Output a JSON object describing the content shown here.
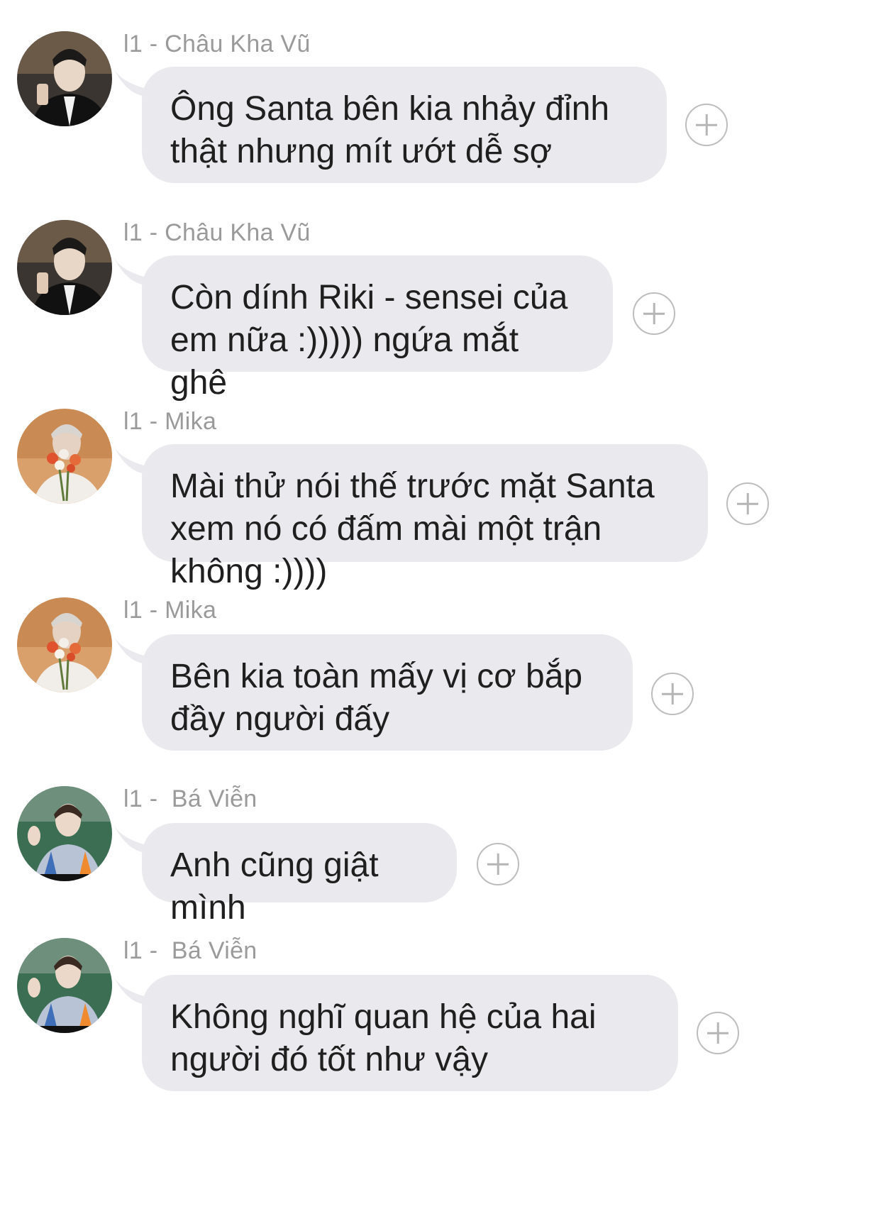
{
  "messages": [
    {
      "sender": "l1 - Châu Kha Vũ",
      "avatar": "avatar-chau-kha-vu",
      "text": "Ông Santa bên kia nhảy đỉnh thật nhưng mít ướt dễ sợ"
    },
    {
      "sender": "l1 - Châu Kha Vũ",
      "avatar": "avatar-chau-kha-vu",
      "text": "Còn dính Riki - sensei của em nữa :))))) ngứa mắt ghê"
    },
    {
      "sender": "l1 - Mika",
      "avatar": "avatar-mika",
      "text": "Mài thử nói thế trước mặt Santa xem nó có đấm mài một trận không :))))"
    },
    {
      "sender": "l1 - Mika",
      "avatar": "avatar-mika",
      "text": "Bên kia toàn mấy vị cơ bắp đầy người đấy"
    },
    {
      "sender": "l1 -  Bá Viễn",
      "avatar": "avatar-ba-vien",
      "text": "Anh cũng giật mình"
    },
    {
      "sender": "l1 -  Bá Viễn",
      "avatar": "avatar-ba-vien",
      "text": "Không nghĩ quan hệ của hai người đó tốt như vậy"
    }
  ],
  "icons": {
    "react": "plus-circle-icon"
  },
  "colors": {
    "bubble": "#e9e9ee",
    "sender_text": "#9a9a9a",
    "message_text": "#1f1f1f",
    "react_border": "#bdbdbd"
  }
}
